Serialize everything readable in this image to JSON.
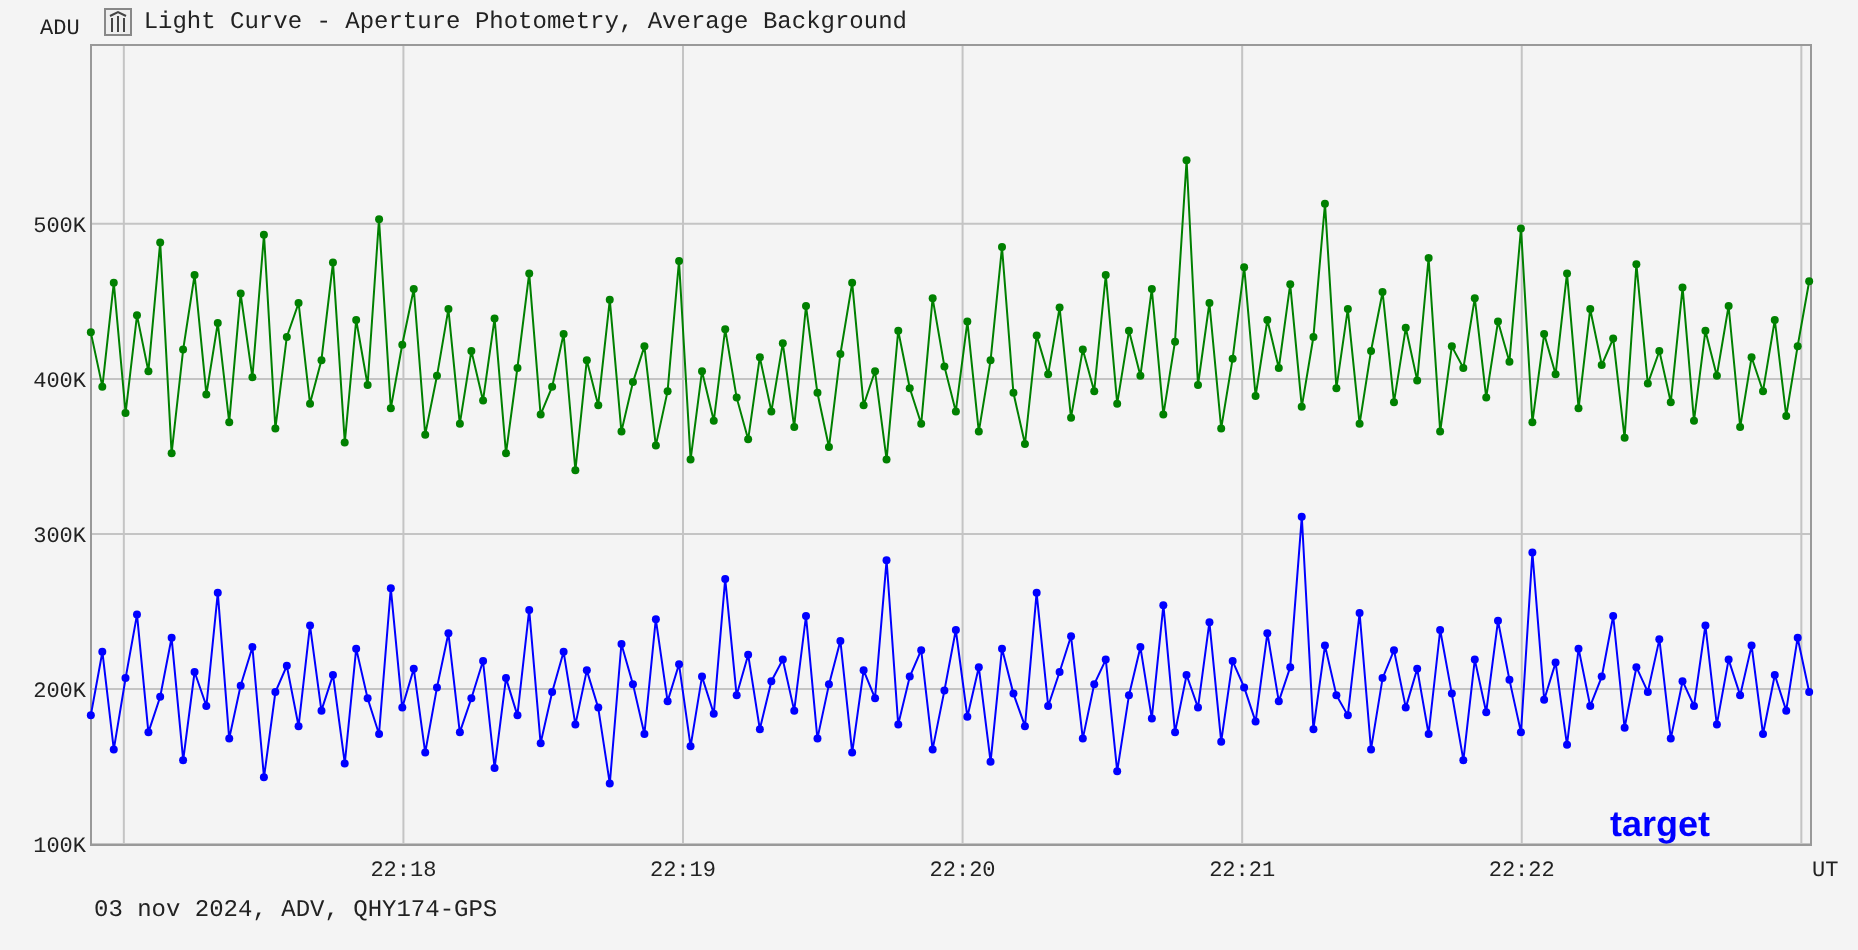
{
  "window": {
    "title": "Light Curve - Aperture Photometry, Average Background"
  },
  "chart": {
    "chart_data": {
      "type": "line",
      "xlabel": "UT",
      "ylabel": "ADU",
      "grid": true,
      "xlim": [
        1336.879,
        1343.031
      ],
      "ylim": [
        100,
        616
      ],
      "x": [
        1336.882,
        1336.923,
        1336.964,
        1337.006,
        1337.047,
        1337.088,
        1337.13,
        1337.171,
        1337.212,
        1337.253,
        1337.295,
        1337.336,
        1337.377,
        1337.418,
        1337.46,
        1337.501,
        1337.542,
        1337.583,
        1337.625,
        1337.666,
        1337.707,
        1337.748,
        1337.79,
        1337.831,
        1337.872,
        1337.913,
        1337.955,
        1337.996,
        1338.037,
        1338.078,
        1338.12,
        1338.161,
        1338.202,
        1338.243,
        1338.285,
        1338.326,
        1338.367,
        1338.408,
        1338.45,
        1338.491,
        1338.532,
        1338.573,
        1338.615,
        1338.656,
        1338.697,
        1338.738,
        1338.78,
        1338.821,
        1338.862,
        1338.903,
        1338.945,
        1338.986,
        1339.027,
        1339.068,
        1339.11,
        1339.151,
        1339.192,
        1339.233,
        1339.275,
        1339.316,
        1339.357,
        1339.398,
        1339.44,
        1339.481,
        1339.522,
        1339.563,
        1339.605,
        1339.646,
        1339.687,
        1339.728,
        1339.77,
        1339.811,
        1339.852,
        1339.893,
        1339.935,
        1339.976,
        1340.017,
        1340.058,
        1340.1,
        1340.141,
        1340.182,
        1340.223,
        1340.265,
        1340.306,
        1340.347,
        1340.388,
        1340.43,
        1340.471,
        1340.512,
        1340.553,
        1340.595,
        1340.636,
        1340.677,
        1340.718,
        1340.76,
        1340.801,
        1340.842,
        1340.883,
        1340.925,
        1340.966,
        1341.007,
        1341.048,
        1341.09,
        1341.131,
        1341.172,
        1341.213,
        1341.255,
        1341.296,
        1341.337,
        1341.378,
        1341.42,
        1341.461,
        1341.502,
        1341.543,
        1341.585,
        1341.626,
        1341.667,
        1341.708,
        1341.75,
        1341.791,
        1341.832,
        1341.873,
        1341.915,
        1341.956,
        1341.997,
        1342.038,
        1342.08,
        1342.121,
        1342.162,
        1342.203,
        1342.245,
        1342.286,
        1342.327,
        1342.368,
        1342.41,
        1342.451,
        1342.492,
        1342.533,
        1342.575,
        1342.616,
        1342.657,
        1342.698,
        1342.74,
        1342.781,
        1342.822,
        1342.863,
        1342.905,
        1342.946,
        1342.987,
        1343.028
      ],
      "xticks": [
        {
          "value": 1338,
          "label": "22:18"
        },
        {
          "value": 1339,
          "label": "22:19"
        },
        {
          "value": 1340,
          "label": "22:20"
        },
        {
          "value": 1341,
          "label": "22:21"
        },
        {
          "value": 1342,
          "label": "22:22"
        }
      ],
      "yticks": [
        {
          "value": 500,
          "label": "500K"
        },
        {
          "value": 400,
          "label": "400K"
        },
        {
          "value": 300,
          "label": "300K"
        },
        {
          "value": 200,
          "label": "200K"
        },
        {
          "value": 100,
          "label": "100K"
        }
      ],
      "series": [
        {
          "color": "#008000",
          "marker": "circle",
          "values": [
            430,
            395,
            462,
            378,
            441,
            405,
            488,
            352,
            419,
            467,
            390,
            436,
            372,
            455,
            401,
            493,
            368,
            427,
            449,
            384,
            412,
            475,
            359,
            438,
            396,
            503,
            381,
            422,
            458,
            364,
            402,
            445,
            371,
            418,
            386,
            439,
            352,
            407,
            468,
            377,
            395,
            429,
            341,
            412,
            383,
            451,
            366,
            398,
            421,
            357,
            392,
            476,
            348,
            405,
            373,
            432,
            388,
            361,
            414,
            379,
            423,
            369,
            447,
            391,
            356,
            416,
            462,
            383,
            405,
            348,
            431,
            394,
            371,
            452,
            408,
            379,
            437,
            366,
            412,
            485,
            391,
            358,
            428,
            403,
            446,
            375,
            419,
            392,
            467,
            384,
            431,
            402,
            458,
            377,
            424,
            541,
            396,
            449,
            368,
            413,
            472,
            389,
            438,
            407,
            461,
            382,
            427,
            513,
            394,
            445,
            371,
            418,
            456,
            385,
            433,
            399,
            478,
            366,
            421,
            407,
            452,
            388,
            437,
            411,
            497,
            372,
            429,
            403,
            468,
            381,
            445,
            409,
            426,
            362,
            474,
            397,
            418,
            385,
            459,
            373,
            431,
            402,
            447,
            369,
            414,
            392,
            438,
            376,
            421,
            463
          ]
        },
        {
          "name": "target",
          "color": "#0000ff",
          "marker": "circle",
          "values": [
            183,
            224,
            161,
            207,
            248,
            172,
            195,
            233,
            154,
            211,
            189,
            262,
            168,
            202,
            227,
            143,
            198,
            215,
            176,
            241,
            186,
            209,
            152,
            226,
            194,
            171,
            265,
            188,
            213,
            159,
            201,
            236,
            172,
            194,
            218,
            149,
            207,
            183,
            251,
            165,
            198,
            224,
            177,
            212,
            188,
            139,
            229,
            203,
            171,
            245,
            192,
            216,
            163,
            208,
            184,
            271,
            196,
            222,
            174,
            205,
            219,
            186,
            247,
            168,
            203,
            231,
            159,
            212,
            194,
            283,
            177,
            208,
            225,
            161,
            199,
            238,
            182,
            214,
            153,
            226,
            197,
            176,
            262,
            189,
            211,
            234,
            168,
            203,
            219,
            147,
            196,
            227,
            181,
            254,
            172,
            209,
            188,
            243,
            166,
            218,
            201,
            179,
            236,
            192,
            214,
            311,
            174,
            228,
            196,
            183,
            249,
            161,
            207,
            225,
            188,
            213,
            171,
            238,
            197,
            154,
            219,
            185,
            244,
            206,
            172,
            288,
            193,
            217,
            164,
            226,
            189,
            208,
            247,
            175,
            214,
            198,
            232,
            168,
            205,
            189,
            241,
            177,
            219,
            196,
            228,
            171,
            209,
            186,
            233,
            198
          ]
        }
      ]
    }
  },
  "footer": "03 nov 2024, ADV, QHY174-GPS"
}
